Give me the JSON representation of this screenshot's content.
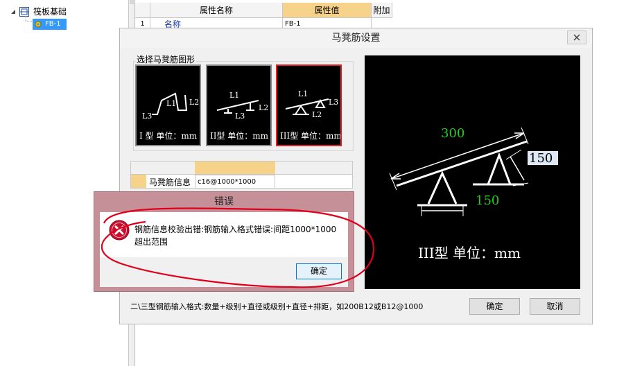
{
  "tree": {
    "root_label": "筏板基础",
    "child_label": "FB-1"
  },
  "property_grid": {
    "col_name": "属性名称",
    "col_value": "属性值",
    "col_extra": "附加",
    "row1_index": "1",
    "row1_name": "名称",
    "row1_value": "FB-1"
  },
  "dialog": {
    "title": "马凳筋设置",
    "shape_group_label": "选择马凳筋图形",
    "shapes": [
      {
        "caption": "I 型 单位：mm",
        "l1": "L1",
        "l2": "L2",
        "l3": "L3",
        "selected": false
      },
      {
        "caption": "II型 单位：mm",
        "l1": "L1",
        "l2": "L2",
        "l3": "L3",
        "selected": false
      },
      {
        "caption": "III型 单位：mm",
        "l1": "L1",
        "l2": "L2",
        "l3": "L3",
        "selected": true
      }
    ],
    "info_label": "马凳筋信息",
    "info_value": "c16@1000*1000",
    "preview": {
      "length_label": "300",
      "height_label": "150",
      "base_label": "150",
      "caption": "III型 单位：mm",
      "length_color": "#22cc22",
      "base_color": "#22cc22"
    },
    "hint": "二\\三型钢筋输入格式:数量+级别+直径或级别+直径+排距，如200B12或B12@1000",
    "ok_label": "确定",
    "cancel_label": "取消"
  },
  "error_dialog": {
    "title": "错误",
    "message": "钢筋信息校验出错:钢筋输入格式错误:间距1000*1000超出范围",
    "ok_label": "确定",
    "icon": "error-icon"
  },
  "colors": {
    "annotation": "#e0001b",
    "selected_border": "#e02020",
    "error_frame": "#c69098"
  }
}
